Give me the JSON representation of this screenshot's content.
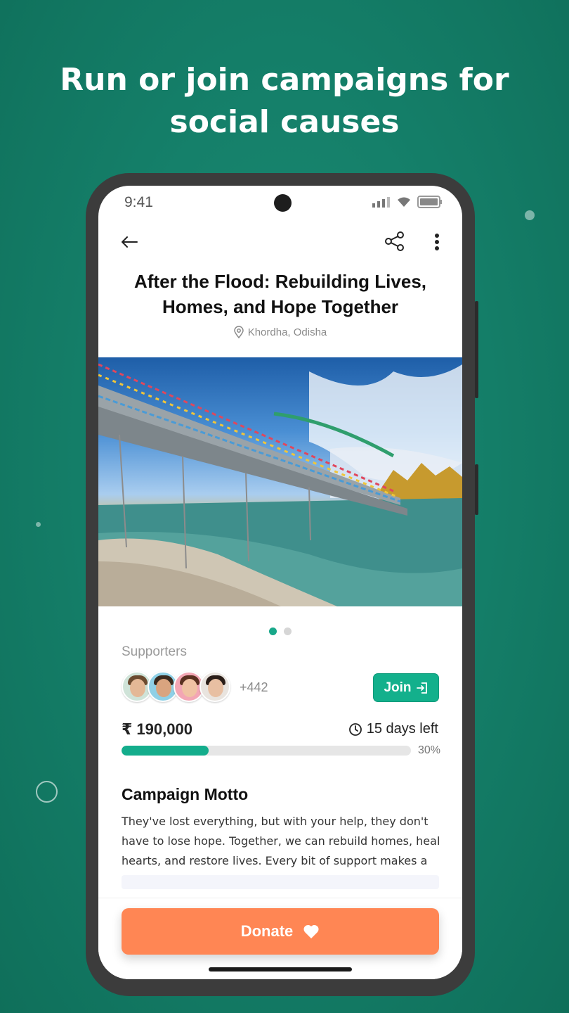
{
  "promo": {
    "headline_line1": "Run or join campaigns for",
    "headline_line2": "social causes"
  },
  "status_bar": {
    "time": "9:41",
    "signal_icon": "signal-icon",
    "wifi_icon": "wifi-icon",
    "battery_icon": "battery-icon"
  },
  "top_bar": {
    "back_icon": "arrow-left-icon",
    "share_icon": "share-icon",
    "more_icon": "more-vertical-icon"
  },
  "campaign": {
    "title_line1": "After the Flood: Rebuilding Lives,",
    "title_line2": "Homes, and Hope Together",
    "location": "Khordha, Odisha",
    "image_icon": "campaign-photo",
    "carousel": {
      "count": 2,
      "active_index": 0
    }
  },
  "supporters": {
    "label": "Supporters",
    "extra_count": "+442",
    "join_label": "Join"
  },
  "funding": {
    "amount": "₹ 190,000",
    "days_left": "15 days left",
    "progress_fraction": 0.3,
    "progress_label": "30%"
  },
  "motto": {
    "heading": "Campaign Motto",
    "text": "They've lost everything, but with your help, they don't have to lose hope. Together, we can rebuild homes, heal hearts, and restore lives. Every bit of support makes a difference"
  },
  "actions": {
    "donate_label": "Donate",
    "donate_icon": "heart-icon"
  },
  "colors": {
    "background": "#15806a",
    "accent_green": "#13b08c",
    "donate_orange": "#ff8654"
  }
}
